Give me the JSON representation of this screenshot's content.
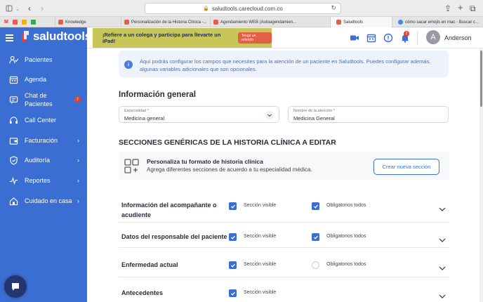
{
  "browser": {
    "url": "saludtools.carecloud.com.co",
    "tabs": [
      {
        "label": "Knowledge",
        "color": "#e35f4a"
      },
      {
        "label": "Personalización de la Historia Clínica -...",
        "color": "#e35f4a"
      },
      {
        "label": "Agendamiento WEB (Autoagendamien...",
        "color": "#e35f4a"
      },
      {
        "label": "Saludtools",
        "color": "#e35f4a"
      },
      {
        "label": "cómo sacar emojis en mac - Buscar c...",
        "color": "#4285f4"
      }
    ]
  },
  "brand": {
    "name": "saludtools"
  },
  "sidebar": {
    "items": [
      {
        "label": "Pacientes",
        "icon": "users-icon"
      },
      {
        "label": "Agenda",
        "icon": "calendar-icon"
      },
      {
        "label": "Chat de Pacientes",
        "icon": "chat-icon",
        "badge": "7"
      },
      {
        "label": "Call Center",
        "icon": "headset-icon"
      },
      {
        "label": "Facturación",
        "icon": "wallet-icon"
      },
      {
        "label": "Auditoría",
        "icon": "shield-icon"
      },
      {
        "label": "Reportes",
        "icon": "pulse-icon"
      },
      {
        "label": "Cuidado en casa",
        "icon": "home-icon"
      }
    ]
  },
  "header": {
    "promo_text": "¡Refiere a un colega y participa para llevarte un iPad!",
    "promo_button": "Tengo un referido",
    "notification_count": "2",
    "avatar_initial": "A",
    "user_name": "Anderson"
  },
  "info": {
    "icon": "i",
    "text": "Aquí podrás configurar los campos que necesites para la atención de un paciente en Saludtools. Puedes configurar además, algunas variables adicionales que son opcionales."
  },
  "general": {
    "title": "Información general",
    "specialty_label": "Especialidad *",
    "specialty_value": "Medicina general",
    "attention_label": "Nombre de la atención *",
    "attention_value": "Medicina General"
  },
  "sections": {
    "title": "SECCIONES GENÉRICAS DE LA HISTORIA CLÍNICA A EDITAR",
    "custom_title": "Personaliza tu formato de historia clínica",
    "custom_subtitle": "Agrega diferentes secciones de acuerdo a tu especialidad médica.",
    "create_button": "Crear nueva sección",
    "visible_label": "Sección visible",
    "required_label": "Obligatorios todos",
    "rows": [
      {
        "title": "Información del acompañante o acudiente",
        "visible": true,
        "required": true
      },
      {
        "title": "Datos del responsable del paciente",
        "visible": true,
        "required": true
      },
      {
        "title": "Enfermedad actual",
        "visible": true,
        "required": false
      },
      {
        "title": "Antecedentes",
        "visible": true,
        "required": null
      }
    ]
  }
}
